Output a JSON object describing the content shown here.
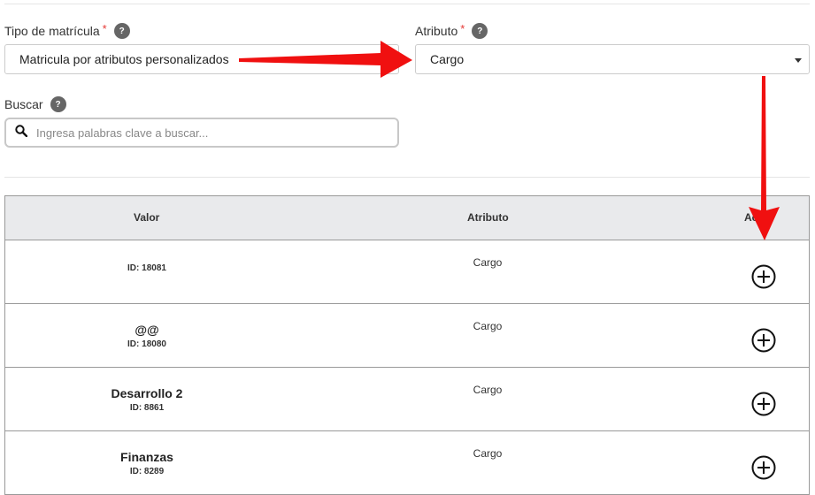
{
  "form": {
    "enrollment_type": {
      "label": "Tipo de matrícula",
      "required_mark": "*",
      "help": "?",
      "value": "Matricula por atributos personalizados"
    },
    "attribute": {
      "label": "Atributo",
      "required_mark": "*",
      "help": "?",
      "value": "Cargo"
    },
    "search": {
      "label": "Buscar",
      "help": "?",
      "placeholder": "Ingresa palabras clave a buscar..."
    }
  },
  "table": {
    "headers": {
      "value": "Valor",
      "attribute": "Atributo",
      "actions": "Ac"
    },
    "rows": [
      {
        "name": "",
        "id": "ID: 18081",
        "attribute": "Cargo"
      },
      {
        "name": "@@",
        "id": "ID: 18080",
        "attribute": "Cargo"
      },
      {
        "name": "Desarrollo 2",
        "id": "ID: 8861",
        "attribute": "Cargo"
      },
      {
        "name": "Finanzas",
        "id": "ID: 8289",
        "attribute": "Cargo"
      }
    ]
  },
  "colors": {
    "arrow": "#f01010",
    "help_badge": "#666666",
    "header_bg": "#e9eaec"
  }
}
